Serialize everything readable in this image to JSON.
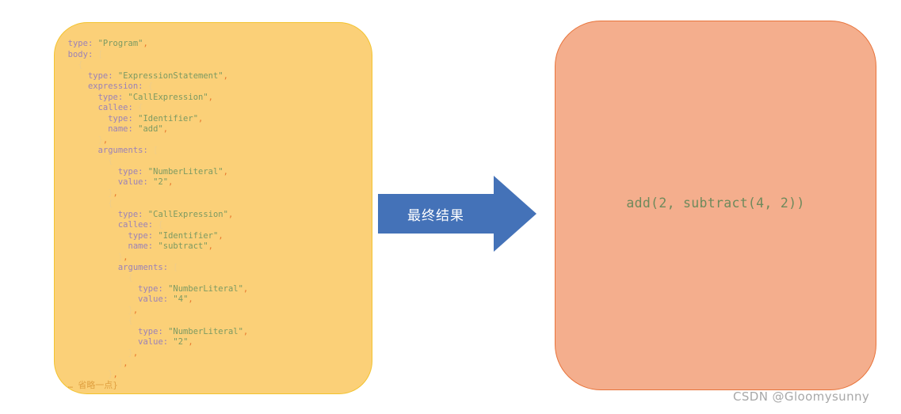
{
  "colors": {
    "ast_panel_fill": "#FBD078",
    "ast_panel_border": "#F3C32F",
    "result_panel_fill": "#F4AE8D",
    "result_panel_border": "#E8743B",
    "arrow_fill": "#4472B8",
    "arrow_label_color": "#FFFFFF",
    "code_key": "#9B82B8",
    "code_string": "#7C9A62",
    "code_punct": "#F0CE87",
    "code_comma": "#E8792E",
    "result_text": "#6E8A5C",
    "watermark": "#A8A8A8"
  },
  "ast_panel": {
    "lines": [
      {
        "indent": 0,
        "tokens": [
          {
            "t": "punct",
            "v": "{"
          }
        ]
      },
      {
        "indent": 1,
        "tokens": [
          {
            "t": "key",
            "v": "type:"
          },
          {
            "t": "sp",
            "v": " "
          },
          {
            "t": "str",
            "v": "\"Program\""
          },
          {
            "t": "comma",
            "v": ","
          }
        ]
      },
      {
        "indent": 1,
        "tokens": [
          {
            "t": "key",
            "v": "body:"
          },
          {
            "t": "sp",
            "v": " "
          },
          {
            "t": "punct",
            "v": "["
          }
        ]
      },
      {
        "indent": 2,
        "tokens": [
          {
            "t": "punct",
            "v": "{"
          }
        ]
      },
      {
        "indent": 3,
        "tokens": [
          {
            "t": "key",
            "v": "type:"
          },
          {
            "t": "sp",
            "v": " "
          },
          {
            "t": "str",
            "v": "\"ExpressionStatement\""
          },
          {
            "t": "comma",
            "v": ","
          }
        ]
      },
      {
        "indent": 3,
        "tokens": [
          {
            "t": "key",
            "v": "expression:"
          },
          {
            "t": "sp",
            "v": " "
          },
          {
            "t": "punct",
            "v": "{"
          }
        ]
      },
      {
        "indent": 4,
        "tokens": [
          {
            "t": "key",
            "v": "type:"
          },
          {
            "t": "sp",
            "v": " "
          },
          {
            "t": "str",
            "v": "\"CallExpression\""
          },
          {
            "t": "comma",
            "v": ","
          }
        ]
      },
      {
        "indent": 4,
        "tokens": [
          {
            "t": "key",
            "v": "callee:"
          },
          {
            "t": "sp",
            "v": " "
          },
          {
            "t": "punct",
            "v": "{"
          }
        ]
      },
      {
        "indent": 5,
        "tokens": [
          {
            "t": "key",
            "v": "type:"
          },
          {
            "t": "sp",
            "v": " "
          },
          {
            "t": "str",
            "v": "\"Identifier\""
          },
          {
            "t": "comma",
            "v": ","
          }
        ]
      },
      {
        "indent": 5,
        "tokens": [
          {
            "t": "key",
            "v": "name:"
          },
          {
            "t": "sp",
            "v": " "
          },
          {
            "t": "str",
            "v": "\"add\""
          },
          {
            "t": "comma",
            "v": ","
          }
        ]
      },
      {
        "indent": 4,
        "tokens": [
          {
            "t": "punct",
            "v": "}"
          },
          {
            "t": "comma",
            "v": ","
          }
        ]
      },
      {
        "indent": 4,
        "tokens": [
          {
            "t": "key",
            "v": "arguments:"
          },
          {
            "t": "sp",
            "v": " "
          },
          {
            "t": "punct",
            "v": "["
          }
        ]
      },
      {
        "indent": 5,
        "tokens": [
          {
            "t": "punct",
            "v": "{"
          }
        ]
      },
      {
        "indent": 6,
        "tokens": [
          {
            "t": "key",
            "v": "type:"
          },
          {
            "t": "sp",
            "v": " "
          },
          {
            "t": "str",
            "v": "\"NumberLiteral\""
          },
          {
            "t": "comma",
            "v": ","
          }
        ]
      },
      {
        "indent": 6,
        "tokens": [
          {
            "t": "key",
            "v": "value:"
          },
          {
            "t": "sp",
            "v": " "
          },
          {
            "t": "str",
            "v": "\"2\""
          },
          {
            "t": "comma",
            "v": ","
          }
        ]
      },
      {
        "indent": 5,
        "tokens": [
          {
            "t": "punct",
            "v": "}"
          },
          {
            "t": "comma",
            "v": ","
          }
        ]
      },
      {
        "indent": 5,
        "tokens": [
          {
            "t": "punct",
            "v": "{"
          }
        ]
      },
      {
        "indent": 6,
        "tokens": [
          {
            "t": "key",
            "v": "type:"
          },
          {
            "t": "sp",
            "v": " "
          },
          {
            "t": "str",
            "v": "\"CallExpression\""
          },
          {
            "t": "comma",
            "v": ","
          }
        ]
      },
      {
        "indent": 6,
        "tokens": [
          {
            "t": "key",
            "v": "callee:"
          },
          {
            "t": "sp",
            "v": " "
          },
          {
            "t": "punct",
            "v": "{"
          }
        ]
      },
      {
        "indent": 7,
        "tokens": [
          {
            "t": "key",
            "v": "type:"
          },
          {
            "t": "sp",
            "v": " "
          },
          {
            "t": "str",
            "v": "\"Identifier\""
          },
          {
            "t": "comma",
            "v": ","
          }
        ]
      },
      {
        "indent": 7,
        "tokens": [
          {
            "t": "key",
            "v": "name:"
          },
          {
            "t": "sp",
            "v": " "
          },
          {
            "t": "str",
            "v": "\"subtract\""
          },
          {
            "t": "comma",
            "v": ","
          }
        ]
      },
      {
        "indent": 6,
        "tokens": [
          {
            "t": "punct",
            "v": "}"
          },
          {
            "t": "comma",
            "v": ","
          }
        ]
      },
      {
        "indent": 6,
        "tokens": [
          {
            "t": "key",
            "v": "arguments:"
          },
          {
            "t": "sp",
            "v": " "
          },
          {
            "t": "punct",
            "v": "["
          }
        ]
      },
      {
        "indent": 7,
        "tokens": [
          {
            "t": "punct",
            "v": "{"
          }
        ]
      },
      {
        "indent": 8,
        "tokens": [
          {
            "t": "key",
            "v": "type:"
          },
          {
            "t": "sp",
            "v": " "
          },
          {
            "t": "str",
            "v": "\"NumberLiteral\""
          },
          {
            "t": "comma",
            "v": ","
          }
        ]
      },
      {
        "indent": 8,
        "tokens": [
          {
            "t": "key",
            "v": "value:"
          },
          {
            "t": "sp",
            "v": " "
          },
          {
            "t": "str",
            "v": "\"4\""
          },
          {
            "t": "comma",
            "v": ","
          }
        ]
      },
      {
        "indent": 7,
        "tokens": [
          {
            "t": "punct",
            "v": "}"
          },
          {
            "t": "comma",
            "v": ","
          }
        ]
      },
      {
        "indent": 7,
        "tokens": [
          {
            "t": "punct",
            "v": "{"
          }
        ]
      },
      {
        "indent": 8,
        "tokens": [
          {
            "t": "key",
            "v": "type:"
          },
          {
            "t": "sp",
            "v": " "
          },
          {
            "t": "str",
            "v": "\"NumberLiteral\""
          },
          {
            "t": "comma",
            "v": ","
          }
        ]
      },
      {
        "indent": 8,
        "tokens": [
          {
            "t": "key",
            "v": "value:"
          },
          {
            "t": "sp",
            "v": " "
          },
          {
            "t": "str",
            "v": "\"2\""
          },
          {
            "t": "comma",
            "v": ","
          }
        ]
      },
      {
        "indent": 7,
        "tokens": [
          {
            "t": "punct",
            "v": "}"
          },
          {
            "t": "comma",
            "v": ","
          }
        ]
      },
      {
        "indent": 6,
        "tokens": [
          {
            "t": "punct",
            "v": "]"
          },
          {
            "t": "comma",
            "v": ","
          }
        ]
      },
      {
        "indent": 5,
        "tokens": [
          {
            "t": "punct",
            "v": "}"
          },
          {
            "t": "comma",
            "v": ","
          }
        ]
      },
      {
        "indent": 1,
        "tokens": [
          {
            "t": "omit",
            "v": "… "
          },
          {
            "t": "omit-cn",
            "v": "省略一点"
          },
          {
            "t": "omit",
            "v": "}"
          }
        ]
      }
    ]
  },
  "arrow": {
    "label": "最终结果",
    "icon": "right-block-arrow-icon"
  },
  "result_panel": {
    "text": "add(2, subtract(4, 2))"
  },
  "watermark": {
    "text": "CSDN @Gloomysunny"
  }
}
